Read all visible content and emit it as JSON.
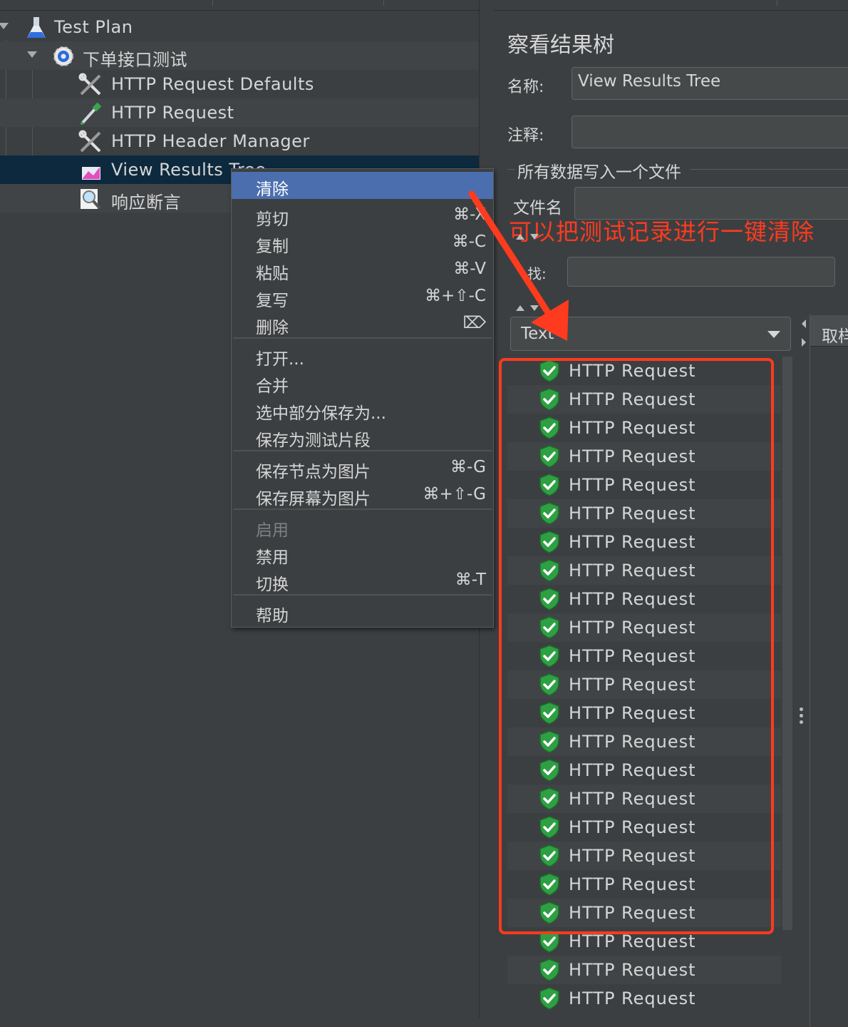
{
  "tree": {
    "nodes": [
      {
        "label": "Test Plan",
        "icon": "flask-icon"
      },
      {
        "label": "下单接口测试",
        "icon": "thread-group-gear-icon"
      },
      {
        "label": "HTTP Request Defaults",
        "icon": "wrench-screwdriver-icon"
      },
      {
        "label": "HTTP Request",
        "icon": "pipette-icon"
      },
      {
        "label": "HTTP Header Manager",
        "icon": "wrench-screwdriver-icon"
      },
      {
        "label": "View Results Tree",
        "icon": "graph-listener-icon"
      },
      {
        "label": "响应断言",
        "icon": "magnifier-assertion-icon"
      }
    ]
  },
  "context_menu": {
    "items": [
      {
        "label": "清除",
        "shortcut": "",
        "state": "highlighted"
      },
      {
        "label": "剪切",
        "shortcut": "⌘-X",
        "state": "normal"
      },
      {
        "label": "复制",
        "shortcut": "⌘-C",
        "state": "normal"
      },
      {
        "label": "粘贴",
        "shortcut": "⌘-V",
        "state": "normal"
      },
      {
        "label": "复写",
        "shortcut": "⌘+⇧-C",
        "state": "normal"
      },
      {
        "label": "删除",
        "shortcut": "⌦",
        "state": "normal"
      },
      {
        "label": "打开...",
        "shortcut": "",
        "state": "normal"
      },
      {
        "label": "合并",
        "shortcut": "",
        "state": "normal"
      },
      {
        "label": "选中部分保存为...",
        "shortcut": "",
        "state": "normal"
      },
      {
        "label": "保存为测试片段",
        "shortcut": "",
        "state": "normal"
      },
      {
        "label": "保存节点为图片",
        "shortcut": "⌘-G",
        "state": "normal"
      },
      {
        "label": "保存屏幕为图片",
        "shortcut": "⌘+⇧-G",
        "state": "normal"
      },
      {
        "label": "启用",
        "shortcut": "",
        "state": "disabled"
      },
      {
        "label": "禁用",
        "shortcut": "",
        "state": "normal"
      },
      {
        "label": "切换",
        "shortcut": "⌘-T",
        "state": "normal"
      },
      {
        "label": "帮助",
        "shortcut": "",
        "state": "normal"
      }
    ]
  },
  "panel": {
    "title": "察看结果树",
    "name_label": "名称:",
    "name_value": "View Results Tree",
    "comment_label": "注释:",
    "comment_value": "",
    "file_group_label": "所有数据写入一个文件",
    "filename_label": "文件名",
    "search_label": "找:",
    "renderer_value": "Text",
    "detail_tab_label": "取样器结果"
  },
  "annotation": {
    "text": "可以把测试记录进行一键清除",
    "color": "#ff3b1f"
  },
  "results": {
    "item_label": "HTTP Request",
    "count": 23,
    "status_icon": "green-shield-check-icon"
  },
  "colors": {
    "background": "#3c3f41",
    "selection": "#0d293e",
    "menu_highlight": "#4b6eaf",
    "success_green": "#2ea043",
    "annotation_red": "#ff3b1f"
  }
}
